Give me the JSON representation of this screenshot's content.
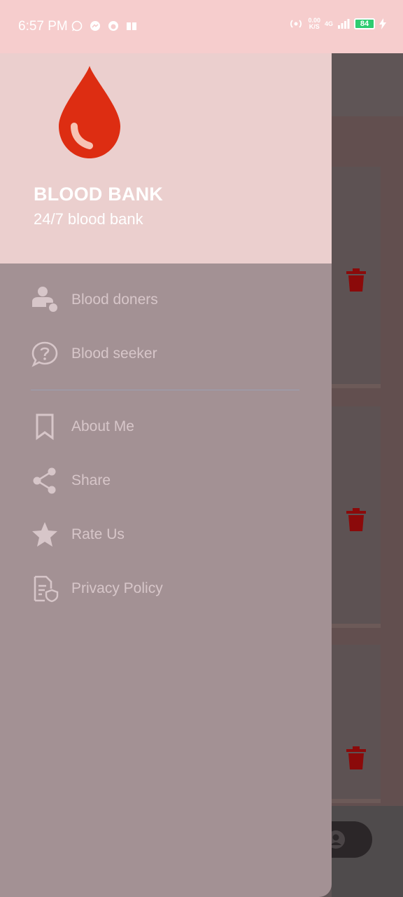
{
  "status_bar": {
    "time": "6:57 PM",
    "net_speed_value": "0.00",
    "net_speed_unit": "K/S",
    "network": "4G",
    "battery": "84"
  },
  "drawer": {
    "title": "BLOOD BANK",
    "subtitle": "24/7 blood bank",
    "items": [
      {
        "label": "Blood doners",
        "icon": "person-donor-icon"
      },
      {
        "label": "Blood seeker",
        "icon": "question-bubble-icon"
      },
      {
        "label": "About Me",
        "icon": "bookmark-icon"
      },
      {
        "label": "Share",
        "icon": "share-icon"
      },
      {
        "label": "Rate Us",
        "icon": "star-icon"
      },
      {
        "label": "Privacy Policy",
        "icon": "policy-document-icon"
      }
    ]
  },
  "colors": {
    "drop_red": "#dd2d12",
    "trash_red": "#8b0a0a",
    "header_bg": "#ebcfce",
    "drawer_bg": "#a39194"
  }
}
